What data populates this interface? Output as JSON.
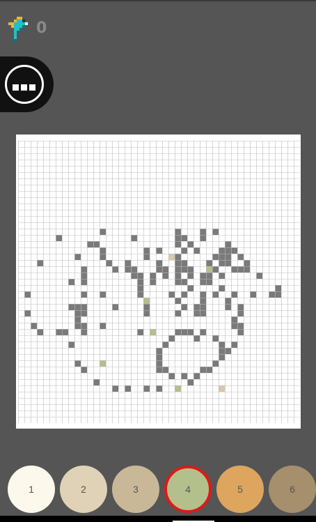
{
  "header": {
    "logo_icon": "pixel-bird-logo-icon",
    "score": "0"
  },
  "menu": {
    "icon": "more-dots-icon"
  },
  "canvas": {
    "columns": 45,
    "rows": 45,
    "background_color": "#ffffff",
    "grid_line_color": "#bdbdbd",
    "unpainted_color": "#7a7a7a",
    "painted_pixels": [
      {
        "row": 14,
        "col": 13,
        "color": "#7a7a7a"
      },
      {
        "row": 14,
        "col": 25,
        "color": "#7a7a7a"
      },
      {
        "row": 14,
        "col": 29,
        "color": "#7a7a7a"
      },
      {
        "row": 14,
        "col": 31,
        "color": "#7a7a7a"
      },
      {
        "row": 15,
        "col": 6,
        "color": "#7a7a7a"
      },
      {
        "row": 15,
        "col": 18,
        "color": "#7a7a7a"
      },
      {
        "row": 15,
        "col": 25,
        "color": "#7a7a7a"
      },
      {
        "row": 15,
        "col": 26,
        "color": "#7a7a7a"
      },
      {
        "row": 15,
        "col": 29,
        "color": "#7a7a7a"
      },
      {
        "row": 16,
        "col": 11,
        "color": "#7a7a7a"
      },
      {
        "row": 16,
        "col": 12,
        "color": "#7a7a7a"
      },
      {
        "row": 16,
        "col": 25,
        "color": "#7a7a7a"
      },
      {
        "row": 16,
        "col": 27,
        "color": "#7a7a7a"
      },
      {
        "row": 16,
        "col": 33,
        "color": "#7a7a7a"
      },
      {
        "row": 17,
        "col": 13,
        "color": "#7a7a7a"
      },
      {
        "row": 17,
        "col": 20,
        "color": "#7a7a7a"
      },
      {
        "row": 17,
        "col": 22,
        "color": "#7a7a7a"
      },
      {
        "row": 17,
        "col": 26,
        "color": "#7a7a7a"
      },
      {
        "row": 17,
        "col": 28,
        "color": "#7a7a7a"
      },
      {
        "row": 17,
        "col": 32,
        "color": "#7a7a7a"
      },
      {
        "row": 17,
        "col": 33,
        "color": "#7a7a7a"
      },
      {
        "row": 17,
        "col": 34,
        "color": "#7a7a7a"
      },
      {
        "row": 18,
        "col": 9,
        "color": "#7a7a7a"
      },
      {
        "row": 18,
        "col": 13,
        "color": "#7a7a7a"
      },
      {
        "row": 18,
        "col": 20,
        "color": "#7a7a7a"
      },
      {
        "row": 18,
        "col": 24,
        "color": "#d8c8ae"
      },
      {
        "row": 18,
        "col": 25,
        "color": "#7a7a7a"
      },
      {
        "row": 18,
        "col": 31,
        "color": "#7a7a7a"
      },
      {
        "row": 18,
        "col": 32,
        "color": "#7a7a7a"
      },
      {
        "row": 18,
        "col": 33,
        "color": "#7a7a7a"
      },
      {
        "row": 18,
        "col": 35,
        "color": "#7a7a7a"
      },
      {
        "row": 19,
        "col": 3,
        "color": "#7a7a7a"
      },
      {
        "row": 19,
        "col": 14,
        "color": "#7a7a7a"
      },
      {
        "row": 19,
        "col": 17,
        "color": "#7a7a7a"
      },
      {
        "row": 19,
        "col": 22,
        "color": "#7a7a7a"
      },
      {
        "row": 19,
        "col": 25,
        "color": "#7a7a7a"
      },
      {
        "row": 19,
        "col": 26,
        "color": "#7a7a7a"
      },
      {
        "row": 19,
        "col": 30,
        "color": "#7a7a7a"
      },
      {
        "row": 19,
        "col": 32,
        "color": "#7a7a7a"
      },
      {
        "row": 19,
        "col": 33,
        "color": "#7a7a7a"
      },
      {
        "row": 19,
        "col": 36,
        "color": "#7a7a7a"
      },
      {
        "row": 20,
        "col": 10,
        "color": "#7a7a7a"
      },
      {
        "row": 20,
        "col": 15,
        "color": "#7a7a7a"
      },
      {
        "row": 20,
        "col": 17,
        "color": "#7a7a7a"
      },
      {
        "row": 20,
        "col": 18,
        "color": "#7a7a7a"
      },
      {
        "row": 20,
        "col": 22,
        "color": "#7a7a7a"
      },
      {
        "row": 20,
        "col": 23,
        "color": "#7a7a7a"
      },
      {
        "row": 20,
        "col": 25,
        "color": "#7a7a7a"
      },
      {
        "row": 20,
        "col": 26,
        "color": "#7a7a7a"
      },
      {
        "row": 20,
        "col": 27,
        "color": "#7a7a7a"
      },
      {
        "row": 20,
        "col": 30,
        "color": "#b4bf8c"
      },
      {
        "row": 20,
        "col": 31,
        "color": "#7a7a7a"
      },
      {
        "row": 20,
        "col": 34,
        "color": "#7a7a7a"
      },
      {
        "row": 20,
        "col": 35,
        "color": "#7a7a7a"
      },
      {
        "row": 20,
        "col": 36,
        "color": "#7a7a7a"
      },
      {
        "row": 21,
        "col": 10,
        "color": "#7a7a7a"
      },
      {
        "row": 21,
        "col": 18,
        "color": "#7a7a7a"
      },
      {
        "row": 21,
        "col": 19,
        "color": "#7a7a7a"
      },
      {
        "row": 21,
        "col": 21,
        "color": "#7a7a7a"
      },
      {
        "row": 21,
        "col": 23,
        "color": "#7a7a7a"
      },
      {
        "row": 21,
        "col": 25,
        "color": "#7a7a7a"
      },
      {
        "row": 21,
        "col": 27,
        "color": "#7a7a7a"
      },
      {
        "row": 21,
        "col": 29,
        "color": "#7a7a7a"
      },
      {
        "row": 21,
        "col": 30,
        "color": "#7a7a7a"
      },
      {
        "row": 21,
        "col": 32,
        "color": "#7a7a7a"
      },
      {
        "row": 21,
        "col": 38,
        "color": "#7a7a7a"
      },
      {
        "row": 22,
        "col": 8,
        "color": "#7a7a7a"
      },
      {
        "row": 22,
        "col": 10,
        "color": "#7a7a7a"
      },
      {
        "row": 22,
        "col": 19,
        "color": "#7a7a7a"
      },
      {
        "row": 22,
        "col": 21,
        "color": "#7a7a7a"
      },
      {
        "row": 22,
        "col": 25,
        "color": "#7a7a7a"
      },
      {
        "row": 22,
        "col": 26,
        "color": "#7a7a7a"
      },
      {
        "row": 22,
        "col": 29,
        "color": "#7a7a7a"
      },
      {
        "row": 22,
        "col": 30,
        "color": "#7a7a7a"
      },
      {
        "row": 23,
        "col": 19,
        "color": "#7a7a7a"
      },
      {
        "row": 23,
        "col": 27,
        "color": "#7a7a7a"
      },
      {
        "row": 23,
        "col": 32,
        "color": "#7a7a7a"
      },
      {
        "row": 23,
        "col": 41,
        "color": "#7a7a7a"
      },
      {
        "row": 24,
        "col": 1,
        "color": "#7a7a7a"
      },
      {
        "row": 24,
        "col": 10,
        "color": "#7a7a7a"
      },
      {
        "row": 24,
        "col": 13,
        "color": "#7a7a7a"
      },
      {
        "row": 24,
        "col": 19,
        "color": "#7a7a7a"
      },
      {
        "row": 24,
        "col": 24,
        "color": "#7a7a7a"
      },
      {
        "row": 24,
        "col": 26,
        "color": "#7a7a7a"
      },
      {
        "row": 24,
        "col": 29,
        "color": "#7a7a7a"
      },
      {
        "row": 24,
        "col": 31,
        "color": "#7a7a7a"
      },
      {
        "row": 24,
        "col": 34,
        "color": "#7a7a7a"
      },
      {
        "row": 24,
        "col": 37,
        "color": "#7a7a7a"
      },
      {
        "row": 24,
        "col": 40,
        "color": "#7a7a7a"
      },
      {
        "row": 24,
        "col": 41,
        "color": "#7a7a7a"
      },
      {
        "row": 25,
        "col": 20,
        "color": "#b4bf8c"
      },
      {
        "row": 25,
        "col": 25,
        "color": "#7a7a7a"
      },
      {
        "row": 25,
        "col": 29,
        "color": "#7a7a7a"
      },
      {
        "row": 25,
        "col": 33,
        "color": "#7a7a7a"
      },
      {
        "row": 26,
        "col": 8,
        "color": "#7a7a7a"
      },
      {
        "row": 26,
        "col": 9,
        "color": "#7a7a7a"
      },
      {
        "row": 26,
        "col": 10,
        "color": "#7a7a7a"
      },
      {
        "row": 26,
        "col": 15,
        "color": "#7a7a7a"
      },
      {
        "row": 26,
        "col": 20,
        "color": "#7a7a7a"
      },
      {
        "row": 26,
        "col": 26,
        "color": "#7a7a7a"
      },
      {
        "row": 26,
        "col": 28,
        "color": "#7a7a7a"
      },
      {
        "row": 26,
        "col": 29,
        "color": "#7a7a7a"
      },
      {
        "row": 26,
        "col": 33,
        "color": "#7a7a7a"
      },
      {
        "row": 26,
        "col": 35,
        "color": "#7a7a7a"
      },
      {
        "row": 27,
        "col": 1,
        "color": "#7a7a7a"
      },
      {
        "row": 27,
        "col": 9,
        "color": "#7a7a7a"
      },
      {
        "row": 27,
        "col": 10,
        "color": "#7a7a7a"
      },
      {
        "row": 27,
        "col": 20,
        "color": "#7a7a7a"
      },
      {
        "row": 27,
        "col": 25,
        "color": "#7a7a7a"
      },
      {
        "row": 27,
        "col": 28,
        "color": "#7a7a7a"
      },
      {
        "row": 27,
        "col": 29,
        "color": "#7a7a7a"
      },
      {
        "row": 27,
        "col": 35,
        "color": "#7a7a7a"
      },
      {
        "row": 28,
        "col": 9,
        "color": "#7a7a7a"
      },
      {
        "row": 28,
        "col": 34,
        "color": "#7a7a7a"
      },
      {
        "row": 29,
        "col": 2,
        "color": "#7a7a7a"
      },
      {
        "row": 29,
        "col": 9,
        "color": "#7a7a7a"
      },
      {
        "row": 29,
        "col": 10,
        "color": "#7a7a7a"
      },
      {
        "row": 29,
        "col": 13,
        "color": "#7a7a7a"
      },
      {
        "row": 29,
        "col": 34,
        "color": "#7a7a7a"
      },
      {
        "row": 29,
        "col": 35,
        "color": "#7a7a7a"
      },
      {
        "row": 30,
        "col": 3,
        "color": "#7a7a7a"
      },
      {
        "row": 30,
        "col": 6,
        "color": "#7a7a7a"
      },
      {
        "row": 30,
        "col": 7,
        "color": "#7a7a7a"
      },
      {
        "row": 30,
        "col": 10,
        "color": "#7a7a7a"
      },
      {
        "row": 30,
        "col": 19,
        "color": "#7a7a7a"
      },
      {
        "row": 30,
        "col": 21,
        "color": "#b4bf8c"
      },
      {
        "row": 30,
        "col": 25,
        "color": "#7a7a7a"
      },
      {
        "row": 30,
        "col": 26,
        "color": "#7a7a7a"
      },
      {
        "row": 30,
        "col": 27,
        "color": "#7a7a7a"
      },
      {
        "row": 30,
        "col": 29,
        "color": "#7a7a7a"
      },
      {
        "row": 30,
        "col": 35,
        "color": "#7a7a7a"
      },
      {
        "row": 31,
        "col": 24,
        "color": "#7a7a7a"
      },
      {
        "row": 31,
        "col": 28,
        "color": "#7a7a7a"
      },
      {
        "row": 31,
        "col": 31,
        "color": "#7a7a7a"
      },
      {
        "row": 32,
        "col": 8,
        "color": "#7a7a7a"
      },
      {
        "row": 32,
        "col": 23,
        "color": "#7a7a7a"
      },
      {
        "row": 32,
        "col": 32,
        "color": "#7a7a7a"
      },
      {
        "row": 32,
        "col": 34,
        "color": "#7a7a7a"
      },
      {
        "row": 33,
        "col": 22,
        "color": "#7a7a7a"
      },
      {
        "row": 33,
        "col": 32,
        "color": "#7a7a7a"
      },
      {
        "row": 33,
        "col": 33,
        "color": "#7a7a7a"
      },
      {
        "row": 34,
        "col": 22,
        "color": "#7a7a7a"
      },
      {
        "row": 34,
        "col": 32,
        "color": "#7a7a7a"
      },
      {
        "row": 35,
        "col": 9,
        "color": "#7a7a7a"
      },
      {
        "row": 35,
        "col": 13,
        "color": "#b4bf8c"
      },
      {
        "row": 35,
        "col": 22,
        "color": "#7a7a7a"
      },
      {
        "row": 35,
        "col": 31,
        "color": "#7a7a7a"
      },
      {
        "row": 36,
        "col": 10,
        "color": "#7a7a7a"
      },
      {
        "row": 36,
        "col": 22,
        "color": "#7a7a7a"
      },
      {
        "row": 36,
        "col": 23,
        "color": "#7a7a7a"
      },
      {
        "row": 36,
        "col": 29,
        "color": "#7a7a7a"
      },
      {
        "row": 36,
        "col": 30,
        "color": "#7a7a7a"
      },
      {
        "row": 37,
        "col": 24,
        "color": "#7a7a7a"
      },
      {
        "row": 37,
        "col": 26,
        "color": "#7a7a7a"
      },
      {
        "row": 37,
        "col": 28,
        "color": "#7a7a7a"
      },
      {
        "row": 38,
        "col": 12,
        "color": "#7a7a7a"
      },
      {
        "row": 38,
        "col": 27,
        "color": "#7a7a7a"
      },
      {
        "row": 39,
        "col": 15,
        "color": "#7a7a7a"
      },
      {
        "row": 39,
        "col": 17,
        "color": "#7a7a7a"
      },
      {
        "row": 39,
        "col": 20,
        "color": "#7a7a7a"
      },
      {
        "row": 39,
        "col": 22,
        "color": "#7a7a7a"
      },
      {
        "row": 39,
        "col": 25,
        "color": "#b4bf8c"
      },
      {
        "row": 39,
        "col": 32,
        "color": "#d8c8ae"
      }
    ]
  },
  "palette": {
    "selected": "4",
    "swatches": [
      {
        "label": "1",
        "color": "#fdf8ec"
      },
      {
        "label": "2",
        "color": "#e0d2b6"
      },
      {
        "label": "3",
        "color": "#c9b898"
      },
      {
        "label": "4",
        "color": "#b4c08c"
      },
      {
        "label": "5",
        "color": "#dda55e"
      },
      {
        "label": "6",
        "color": "#a58f6c"
      }
    ]
  }
}
